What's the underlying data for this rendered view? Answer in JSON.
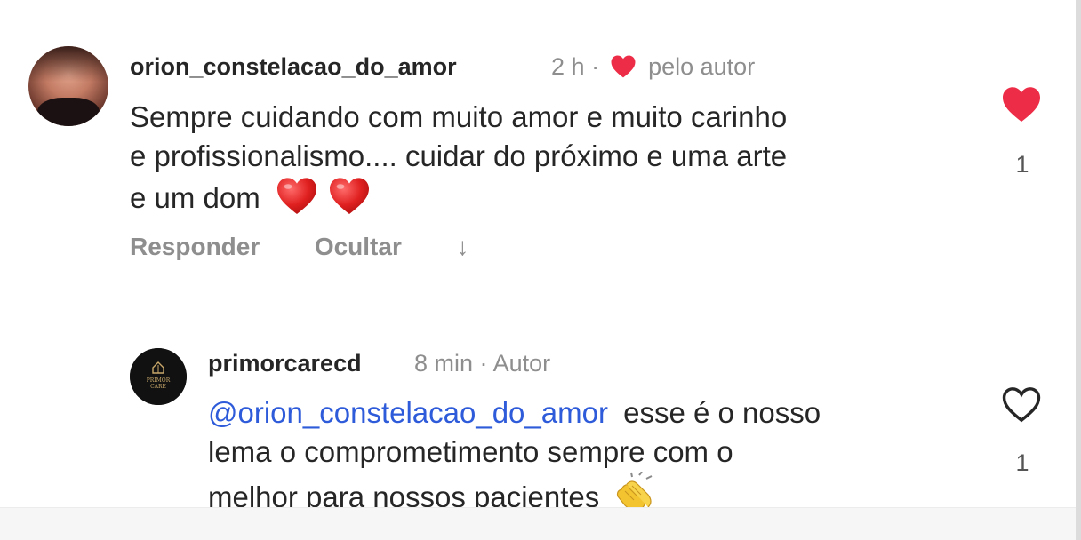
{
  "comment": {
    "username": "orion_constelacao_do_amor",
    "time": "2 h",
    "dot": "·",
    "author_liked_label": "pelo autor",
    "text_lines": [
      "Sempre cuidando com muito amor e muito carinho",
      "e profissionalismo.... cuidar do próximo e uma arte",
      "e um dom"
    ],
    "actions": {
      "reply_label": "Responder",
      "hide_label": "Ocultar",
      "down_arrow": "↓"
    },
    "like_count": "1",
    "liked": true
  },
  "reply": {
    "username": "primorcarecd",
    "time": "8 min",
    "dot": "·",
    "badge": "Autor",
    "mention": "@orion_constelacao_do_amor",
    "text_first_rest": " esse é o nosso",
    "text_lines": [
      "lema o comprometimento sempre com o",
      "melhor para nossos pacientes"
    ],
    "like_count": "1",
    "liked": false,
    "avatar_text": "PRIMOR CARE"
  },
  "colors": {
    "heart_red": "#ed2d47",
    "mention_blue": "#2e5bd9",
    "muted": "#8e8e8e"
  }
}
